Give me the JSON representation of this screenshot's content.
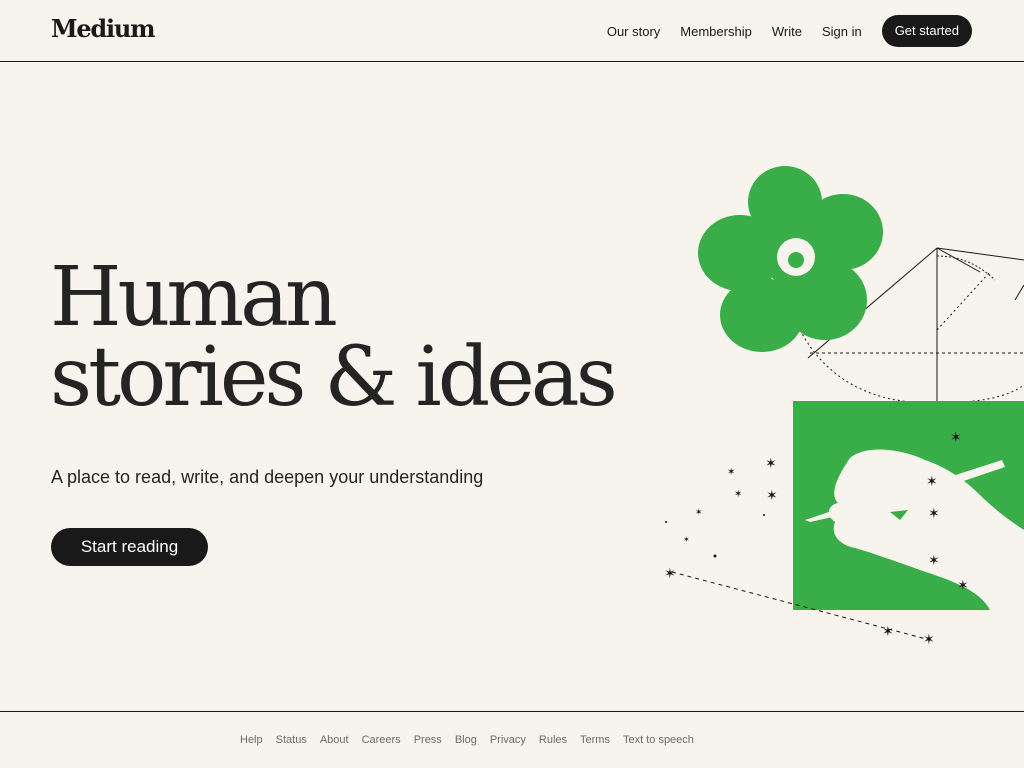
{
  "brand": {
    "logo_text": "Medium"
  },
  "nav": {
    "our_story": "Our story",
    "membership": "Membership",
    "write": "Write",
    "sign_in": "Sign in",
    "get_started": "Get started"
  },
  "hero": {
    "title_line1": "Human",
    "title_line2": "stories & ideas",
    "subtitle": "A place to read, write, and deepen your understanding",
    "cta": "Start reading"
  },
  "footer": {
    "links": [
      "Help",
      "Status",
      "About",
      "Careers",
      "Press",
      "Blog",
      "Privacy",
      "Rules",
      "Terms",
      "Text to speech"
    ]
  },
  "colors": {
    "background": "#F7F4ED",
    "text": "#191919",
    "accent_green": "#38AD48",
    "muted": "#6B6B6B"
  },
  "illustration": {
    "icon": "flower-and-hand-writing-illustration"
  }
}
